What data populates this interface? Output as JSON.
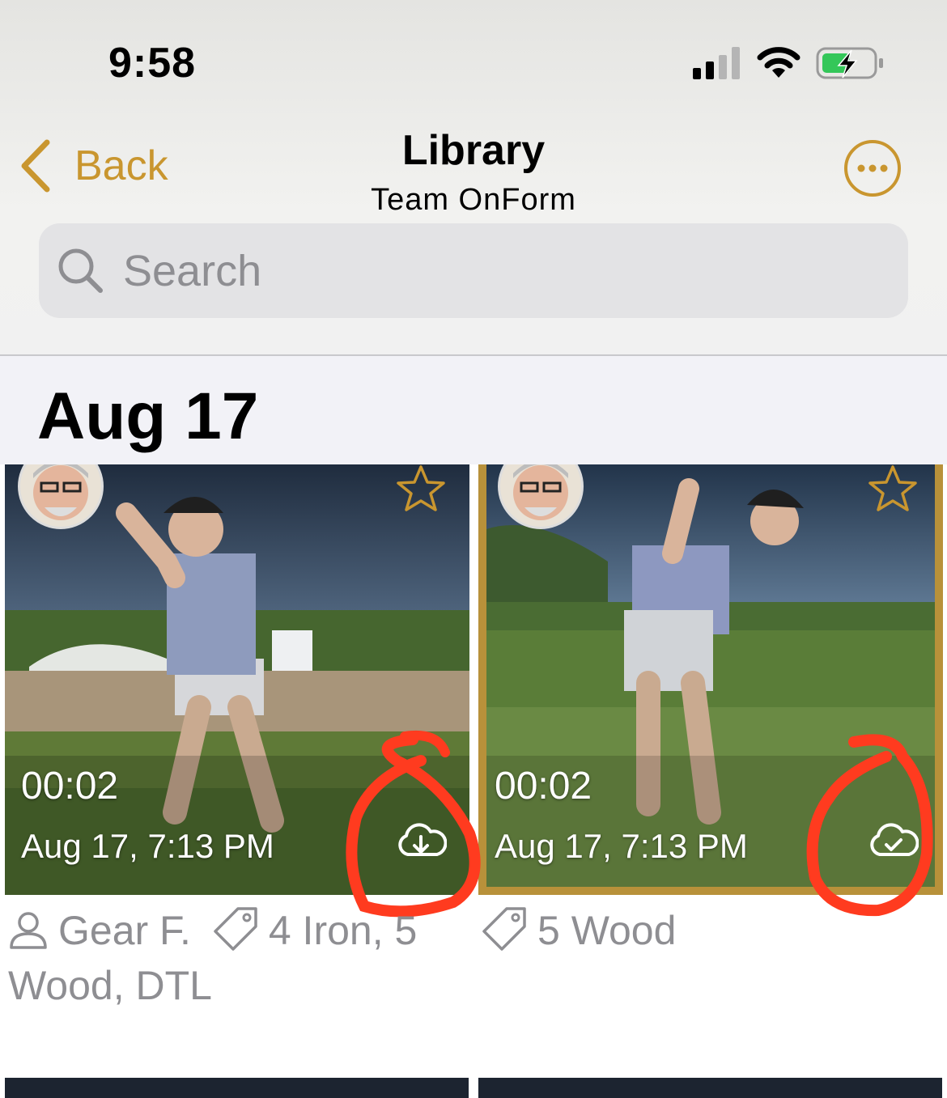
{
  "status_bar": {
    "time": "9:58"
  },
  "nav": {
    "back_label": "Back",
    "title": "Library",
    "subtitle": "Team OnForm"
  },
  "search": {
    "placeholder": "Search"
  },
  "section": {
    "title": "Aug 17"
  },
  "videos": [
    {
      "duration": "00:02",
      "datetime": "Aug 17, 7:13 PM",
      "cloud_status": "download",
      "starred": false,
      "person": "Gear F.",
      "tags": "4 Iron, 5 Wood, DTL"
    },
    {
      "duration": "00:02",
      "datetime": "Aug 17, 7:13 PM",
      "cloud_status": "downloaded",
      "starred": false,
      "selected": true,
      "tags": "5 Wood"
    }
  ],
  "colors": {
    "accent": "#c9962f",
    "annotation": "#ff3b1f",
    "selected_border": "#b8913a"
  }
}
